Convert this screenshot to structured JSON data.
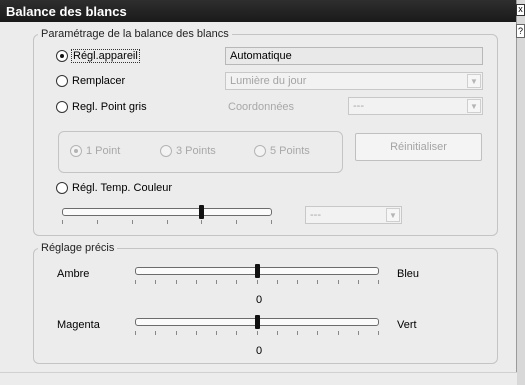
{
  "window": {
    "title": "Balance des blancs",
    "close_glyph": "x",
    "help_glyph": "?"
  },
  "wb_settings": {
    "legend": "Paramétrage de la balance des blancs",
    "as_shot": {
      "label": "Régl.appareil",
      "value": "Automatique",
      "selected": true
    },
    "replace": {
      "label": "Remplacer",
      "value": "Lumière du jour"
    },
    "gray_point": {
      "label": "Regl. Point gris",
      "coords_label": "Coordonnées",
      "coords_value": "---",
      "points": [
        "1 Point",
        "3 Points",
        "5 Points"
      ],
      "selected_point": "1 Point",
      "reset_label": "Réinitialiser"
    },
    "color_temp": {
      "label": "Régl. Temp. Couleur",
      "value": "---",
      "slider_level": 0.66
    }
  },
  "fine_tune": {
    "legend": "Réglage précis",
    "amber_blue": {
      "left_label": "Ambre",
      "right_label": "Bleu",
      "value": "0",
      "level": 0.5
    },
    "magenta_green": {
      "left_label": "Magenta",
      "right_label": "Vert",
      "value": "0",
      "level": 0.5
    }
  },
  "colors": {
    "title_bar": "#1f1f1f",
    "window_bg": "#ececec",
    "disabled_text": "#a8a8a8"
  }
}
